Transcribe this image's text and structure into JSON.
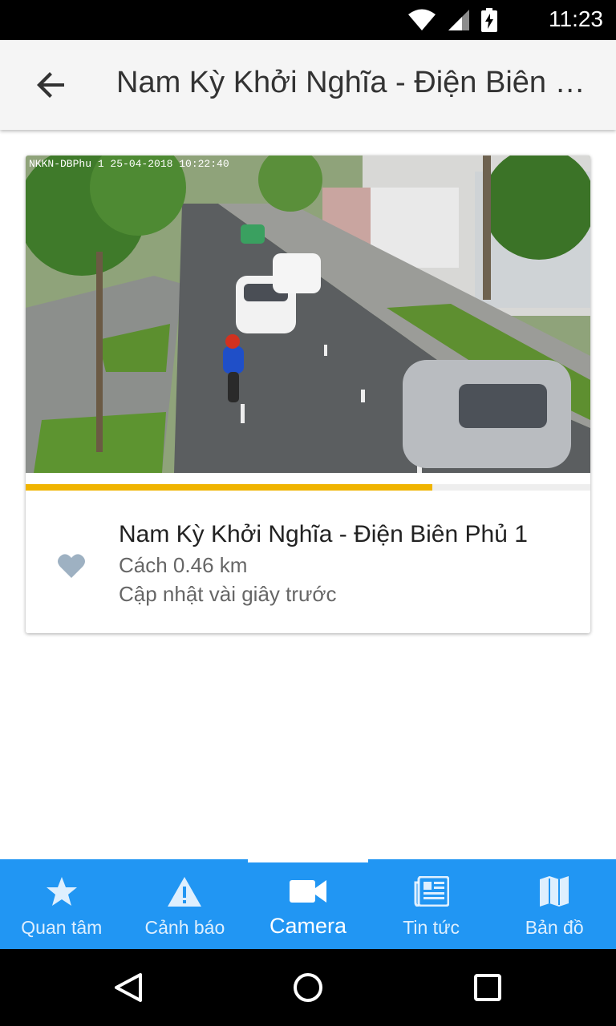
{
  "status_bar": {
    "time": "11:23",
    "icons": [
      "wifi-icon",
      "signal-icon",
      "battery-charging-icon"
    ]
  },
  "app_bar": {
    "title": "Nam Kỳ Khởi Nghĩa - Điện Biên Phủ 1",
    "back_icon": "arrow-back-icon"
  },
  "camera_card": {
    "overlay_text": "NKKN-DBPhu 1 25-04-2018 10:22:40",
    "progress": 0.72,
    "progress_color": "#f0b400",
    "title": "Nam Kỳ Khởi Nghĩa - Điện Biên Phủ 1",
    "distance": "Cách 0.46 km",
    "updated": "Cập nhật vài giây trước",
    "favorite_icon": "heart-icon"
  },
  "bottom_nav": {
    "items": [
      {
        "label": "Quan tâm",
        "icon": "star-icon",
        "active": false
      },
      {
        "label": "Cảnh báo",
        "icon": "warning-icon",
        "active": false
      },
      {
        "label": "Camera",
        "icon": "videocam-icon",
        "active": true
      },
      {
        "label": "Tin tức",
        "icon": "news-icon",
        "active": false
      },
      {
        "label": "Bản đồ",
        "icon": "map-icon",
        "active": false
      }
    ],
    "accent_color": "#2196f3"
  },
  "system_nav": {
    "icons": [
      "back-triangle-icon",
      "home-circle-icon",
      "recents-square-icon"
    ]
  }
}
